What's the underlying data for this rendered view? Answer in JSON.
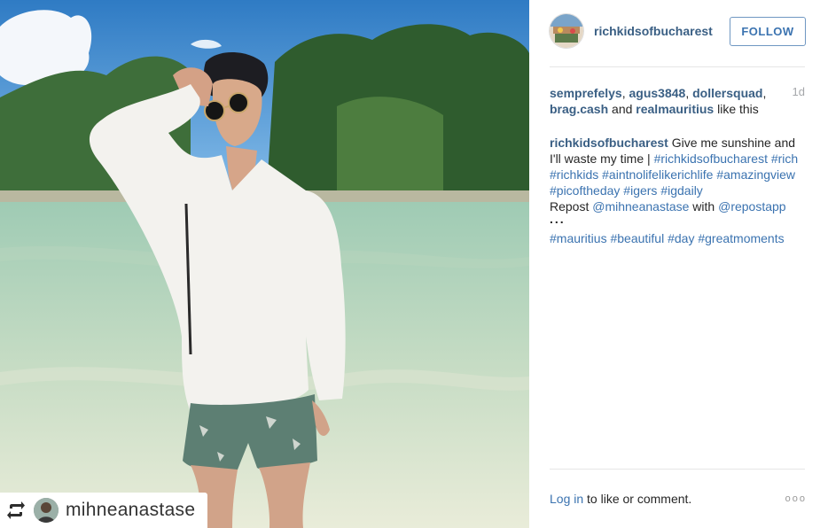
{
  "post": {
    "account": "richkidsofbucharest",
    "follow_label": "FOLLOW",
    "time": "1d",
    "likes": {
      "users": [
        "semprefelys",
        "agus3848",
        "dollersquad",
        "brag.cash",
        "realmauritius"
      ],
      "sep": ", ",
      "and": " and ",
      "suffix": " like this"
    },
    "caption": {
      "user": "richkidsofbucharest",
      "text1": " Give me sunshine and I'll waste my time | ",
      "tags1": [
        "#richkidsofbucharest",
        "#rich",
        "#richkids",
        "#aintnolifelikerichlife",
        "#amazingview",
        "#picoftheday",
        "#igers",
        "#igdaily"
      ],
      "repost_word": "Repost ",
      "repost_user": "@mihneanastase",
      "with_word": " with ",
      "repost_app": "@repostapp",
      "dots": "...",
      "tags2": [
        "#mauritius",
        "#beautiful",
        "#day",
        "#greatmoments"
      ]
    },
    "footer": {
      "login": "Log in",
      "rest": " to like or comment.",
      "more": "ooo"
    }
  },
  "repost_badge": {
    "handle": "mihneanastase",
    "icon": "repost-icon"
  },
  "colors": {
    "link": "#3b73b0",
    "username": "#3a5f84",
    "follow_border": "#6f97c2"
  }
}
